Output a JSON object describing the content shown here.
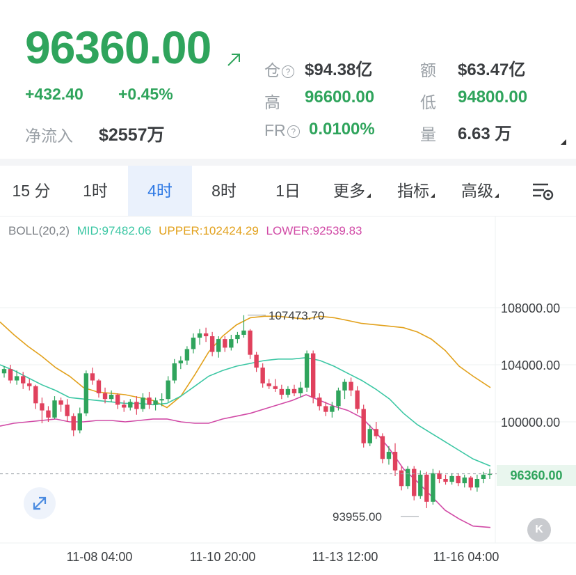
{
  "ticker": {
    "price": "96360.00",
    "change_abs": "+432.40",
    "change_pct": "+0.45%",
    "net_inflow_label": "净流入",
    "net_inflow_value": "$2557万",
    "trend_icon": "arrow-up-right-icon",
    "accent_color": "#2fa45c"
  },
  "stats": {
    "open_interest_label": "仓",
    "open_interest_value": "$94.38亿",
    "turnover_label": "额",
    "turnover_value": "$63.47亿",
    "high_label": "高",
    "high_value": "96600.00",
    "low_label": "低",
    "low_value": "94800.00",
    "fr_label": "FR",
    "fr_value": "0.0100%",
    "volume_label": "量",
    "volume_value": "6.63 万"
  },
  "tabs": [
    {
      "label": "15 分"
    },
    {
      "label": "1时"
    },
    {
      "label": "4时",
      "active": true
    },
    {
      "label": "8时"
    },
    {
      "label": "1日"
    },
    {
      "label": "更多"
    },
    {
      "label": "指标"
    },
    {
      "label": "高级"
    }
  ],
  "indicator": {
    "name": "BOLL(20,2)",
    "mid": "MID:97482.06",
    "upper": "UPPER:102424.29",
    "lower": "LOWER:92539.83",
    "mid_color": "#3cc7a4",
    "upper_color": "#e2a11c",
    "lower_color": "#d14aa6"
  },
  "chart_data": {
    "type": "candlestick",
    "y_ticks": [
      "108000.00",
      "104000.00",
      "100000.00"
    ],
    "x_ticks": [
      "11-08 04:00",
      "11-10 20:00",
      "11-13 12:00",
      "11-16 04:00"
    ],
    "ylim": [
      92000,
      110000
    ],
    "current_price_label": "96360.00",
    "current_price": 96360,
    "max_annotation": "107473.70",
    "max_value": 107473.7,
    "min_annotation": "93955.00",
    "min_value": 93955,
    "up_color": "#2fa45c",
    "down_color": "#e0415d",
    "candles": [
      [
        103400,
        103900,
        103100,
        103700
      ],
      [
        103700,
        104000,
        102700,
        102900
      ],
      [
        102900,
        103600,
        102600,
        103200
      ],
      [
        103200,
        103500,
        102300,
        102700
      ],
      [
        102700,
        103000,
        102200,
        102500
      ],
      [
        102500,
        102600,
        100900,
        101300
      ],
      [
        101300,
        101700,
        99900,
        100800
      ],
      [
        100800,
        101100,
        100000,
        100300
      ],
      [
        100300,
        101800,
        100200,
        101500
      ],
      [
        101500,
        101700,
        100700,
        101200
      ],
      [
        101200,
        101600,
        100000,
        100400
      ],
      [
        100400,
        100600,
        99000,
        99400
      ],
      [
        99400,
        101000,
        99200,
        100600
      ],
      [
        100600,
        103600,
        100400,
        103400
      ],
      [
        103400,
        103800,
        102600,
        102900
      ],
      [
        102900,
        103000,
        101700,
        102000
      ],
      [
        102000,
        102400,
        101300,
        101600
      ],
      [
        101600,
        102200,
        101400,
        101900
      ],
      [
        101900,
        102000,
        100900,
        101200
      ],
      [
        101200,
        101500,
        100700,
        101000
      ],
      [
        101000,
        101600,
        100800,
        101400
      ],
      [
        101400,
        101800,
        100500,
        100900
      ],
      [
        100900,
        102000,
        100700,
        101700
      ],
      [
        101700,
        102100,
        100900,
        101200
      ],
      [
        101200,
        101700,
        100800,
        101500
      ],
      [
        101500,
        102000,
        101100,
        101600
      ],
      [
        101600,
        103200,
        101400,
        102900
      ],
      [
        102900,
        104400,
        102700,
        104100
      ],
      [
        104100,
        104600,
        103700,
        104300
      ],
      [
        104300,
        105300,
        104000,
        105100
      ],
      [
        105100,
        106200,
        104800,
        105900
      ],
      [
        105900,
        106500,
        105400,
        106200
      ],
      [
        106200,
        106600,
        105600,
        106000
      ],
      [
        106000,
        106300,
        104600,
        104900
      ],
      [
        104900,
        106000,
        104500,
        105800
      ],
      [
        105800,
        106000,
        104900,
        105200
      ],
      [
        105200,
        106100,
        105000,
        105800
      ],
      [
        105800,
        106300,
        105500,
        106100
      ],
      [
        106100,
        107473.7,
        105900,
        106400
      ],
      [
        106400,
        106500,
        104400,
        104700
      ],
      [
        104700,
        104900,
        103500,
        103800
      ],
      [
        103800,
        104100,
        102400,
        102700
      ],
      [
        102700,
        103000,
        102300,
        102500
      ],
      [
        102500,
        103000,
        102100,
        102300
      ],
      [
        102300,
        102600,
        101600,
        101900
      ],
      [
        101900,
        102500,
        101700,
        102300
      ],
      [
        102300,
        102600,
        101800,
        102000
      ],
      [
        102000,
        102800,
        101700,
        102400
      ],
      [
        102400,
        105000,
        102100,
        104800
      ],
      [
        104800,
        105000,
        101300,
        101700
      ],
      [
        101700,
        102000,
        100800,
        101100
      ],
      [
        101100,
        101400,
        100400,
        100700
      ],
      [
        100700,
        101400,
        100300,
        101100
      ],
      [
        101100,
        102400,
        100800,
        102200
      ],
      [
        102200,
        103000,
        101600,
        102800
      ],
      [
        102800,
        103100,
        101800,
        102200
      ],
      [
        102200,
        102500,
        100600,
        100900
      ],
      [
        100900,
        101200,
        98200,
        98500
      ],
      [
        98500,
        99800,
        98300,
        99500
      ],
      [
        99500,
        100000,
        98800,
        99000
      ],
      [
        99000,
        99200,
        97100,
        97400
      ],
      [
        97400,
        98300,
        97000,
        97900
      ],
      [
        97900,
        98500,
        96200,
        96600
      ],
      [
        96600,
        96900,
        95200,
        95500
      ],
      [
        95500,
        96900,
        95300,
        96700
      ],
      [
        96700,
        96900,
        94500,
        94800
      ],
      [
        94800,
        96600,
        94600,
        96300
      ],
      [
        96300,
        96500,
        93955,
        94400
      ],
      [
        94400,
        96700,
        94200,
        96400
      ],
      [
        96400,
        96600,
        95700,
        96000
      ],
      [
        96000,
        96300,
        95600,
        95800
      ],
      [
        95800,
        96400,
        95600,
        96200
      ],
      [
        96200,
        96400,
        95500,
        95700
      ],
      [
        95700,
        96300,
        95400,
        96100
      ],
      [
        96100,
        96200,
        95200,
        95400
      ],
      [
        95400,
        96300,
        95100,
        96000
      ],
      [
        96000,
        96500,
        95700,
        96300
      ],
      [
        96300,
        96700,
        96000,
        96360
      ]
    ],
    "boll_upper": [
      [
        0,
        107000
      ],
      [
        20,
        106100
      ],
      [
        40,
        105300
      ],
      [
        60,
        104600
      ],
      [
        80,
        103800
      ],
      [
        100,
        103200
      ],
      [
        120,
        102400
      ],
      [
        140,
        102100
      ],
      [
        160,
        102000
      ],
      [
        180,
        101900
      ],
      [
        200,
        101700
      ],
      [
        220,
        101500
      ],
      [
        240,
        101000
      ],
      [
        260,
        101800
      ],
      [
        280,
        103300
      ],
      [
        300,
        104900
      ],
      [
        320,
        106000
      ],
      [
        340,
        106800
      ],
      [
        360,
        107300
      ],
      [
        380,
        107400
      ],
      [
        400,
        107400
      ],
      [
        420,
        107300
      ],
      [
        440,
        107200
      ],
      [
        460,
        107400
      ],
      [
        480,
        107300
      ],
      [
        500,
        107100
      ],
      [
        520,
        106900
      ],
      [
        540,
        106800
      ],
      [
        560,
        106700
      ],
      [
        580,
        106600
      ],
      [
        600,
        106300
      ],
      [
        620,
        105800
      ],
      [
        640,
        105000
      ],
      [
        660,
        103900
      ],
      [
        680,
        103200
      ],
      [
        705,
        102400
      ]
    ],
    "boll_mid": [
      [
        0,
        104000
      ],
      [
        20,
        103600
      ],
      [
        40,
        103100
      ],
      [
        60,
        102600
      ],
      [
        80,
        102200
      ],
      [
        100,
        101700
      ],
      [
        120,
        101600
      ],
      [
        140,
        101500
      ],
      [
        160,
        101400
      ],
      [
        180,
        101300
      ],
      [
        200,
        101300
      ],
      [
        220,
        101200
      ],
      [
        240,
        101300
      ],
      [
        260,
        101800
      ],
      [
        280,
        102500
      ],
      [
        300,
        103200
      ],
      [
        320,
        103600
      ],
      [
        340,
        103900
      ],
      [
        360,
        104100
      ],
      [
        380,
        104300
      ],
      [
        400,
        104400
      ],
      [
        420,
        104400
      ],
      [
        440,
        104500
      ],
      [
        460,
        104300
      ],
      [
        480,
        103900
      ],
      [
        500,
        103400
      ],
      [
        520,
        102900
      ],
      [
        540,
        102300
      ],
      [
        560,
        101600
      ],
      [
        580,
        100600
      ],
      [
        600,
        99800
      ],
      [
        620,
        99200
      ],
      [
        640,
        98600
      ],
      [
        660,
        98000
      ],
      [
        680,
        97400
      ],
      [
        705,
        96900
      ]
    ],
    "boll_lower": [
      [
        0,
        99700
      ],
      [
        20,
        99900
      ],
      [
        40,
        100000
      ],
      [
        60,
        100100
      ],
      [
        80,
        100200
      ],
      [
        100,
        100000
      ],
      [
        120,
        100000
      ],
      [
        140,
        100100
      ],
      [
        160,
        100100
      ],
      [
        180,
        100000
      ],
      [
        200,
        100100
      ],
      [
        220,
        100200
      ],
      [
        240,
        100200
      ],
      [
        260,
        100000
      ],
      [
        280,
        99900
      ],
      [
        300,
        99900
      ],
      [
        320,
        100200
      ],
      [
        340,
        100400
      ],
      [
        360,
        100600
      ],
      [
        380,
        100900
      ],
      [
        400,
        101200
      ],
      [
        420,
        101500
      ],
      [
        440,
        101900
      ],
      [
        460,
        101500
      ],
      [
        480,
        101100
      ],
      [
        500,
        100800
      ],
      [
        520,
        100300
      ],
      [
        540,
        99300
      ],
      [
        560,
        98100
      ],
      [
        580,
        96700
      ],
      [
        600,
        95800
      ],
      [
        620,
        94800
      ],
      [
        640,
        93800
      ],
      [
        660,
        93200
      ],
      [
        680,
        92700
      ],
      [
        705,
        92600
      ]
    ]
  }
}
